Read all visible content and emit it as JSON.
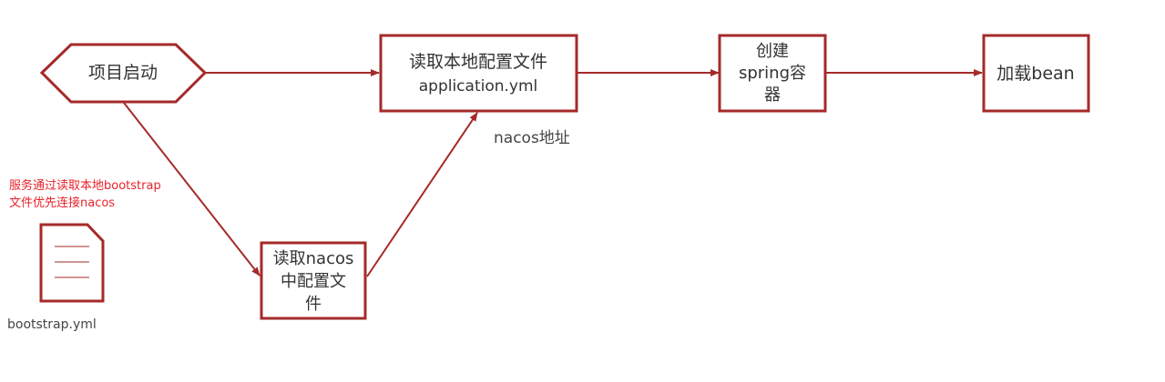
{
  "colors": {
    "stroke": "#a52a2a",
    "annotation": "#e8232a",
    "text": "#333333"
  },
  "nodes": {
    "start": {
      "label": "项目启动"
    },
    "read_local": {
      "line1": "读取本地配置文件",
      "line2": "application.yml"
    },
    "create_container": {
      "line1": "创建",
      "line2": "spring容",
      "line3": "器"
    },
    "load_bean": {
      "label": "加载bean"
    },
    "read_nacos": {
      "line1": "读取nacos",
      "line2": "中配置文",
      "line3": "件"
    }
  },
  "edge_labels": {
    "nacos_address": "nacos地址"
  },
  "annotation": {
    "line1": "服务通过读取本地bootstrap",
    "line2": "文件优先连接nacos"
  },
  "file": {
    "caption": "bootstrap.yml"
  }
}
